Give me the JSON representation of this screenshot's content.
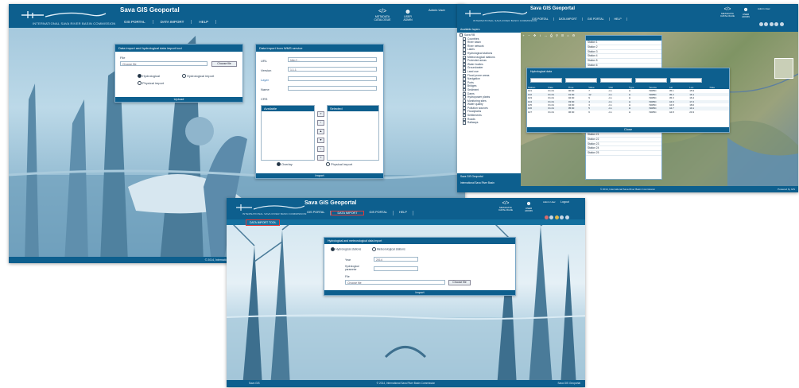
{
  "app_title": "Sava GIS Geoportal",
  "logo_caption": "INTERNATIONAL SAVA RIVER BASIN COMMISSION",
  "nav": [
    "GIS PORTAL",
    "DATA IMPORT",
    "GIS PORTAL",
    "HELP"
  ],
  "header_icons": {
    "metadata": "METADATA CATALOGUE",
    "user": "USER ADMIN",
    "admin_user": "Admin User",
    "logout": "Logout"
  },
  "screen1": {
    "panel_left": {
      "title": "Data import and hydrological data import tool",
      "file_label": "File",
      "file_placeholder": "Choose file",
      "choose_button": "Choose file",
      "radio_a": "Hydrological",
      "radio_b": "Hydrological import",
      "radio_c": "Physical import",
      "bar_label": "Upload"
    },
    "panel_right": {
      "title": "Data import from WMS service",
      "url_label": "URL",
      "url_value": "http://...",
      "version_label": "Version",
      "version_value": "1.1.1",
      "layer_label": "Layer",
      "name_label": "Name",
      "crs_label": "CRS",
      "available_label": "Available",
      "selected_label": "Selected",
      "radio_a": "Overlay",
      "radio_b": "Physical import",
      "bar_label": "Import"
    },
    "footer": "© 2014, International Sava River Basin Commission"
  },
  "screen2": {
    "tree_title": "Available layers",
    "tree_items": [
      "Sava RB",
      "Countries",
      "River basin",
      "River network",
      "Lakes",
      "Hydrological stations",
      "Meteorological stations",
      "Protected areas",
      "Water bodies",
      "Groundwater",
      "Land use",
      "Flood prone areas",
      "Navigation",
      "Ports",
      "Bridges",
      "Sediment",
      "Dams",
      "Hydropower plants",
      "Monitoring sites",
      "Water quality",
      "Pollution sources",
      "Floodplains",
      "Settlements",
      "Roads",
      "Railways"
    ],
    "tree_footer_1": "Sava GIS Geoportal",
    "tree_footer_2": "International Sava River Basin",
    "grid_title": "Hydrological data",
    "grid_headers": [
      "Station",
      "Date",
      "Time",
      "Value",
      "Unit",
      "Type",
      "Source",
      "Lat",
      "Lon",
      "Note"
    ],
    "grid_rows": [
      [
        "101",
        "01.01",
        "00:00",
        "7",
        "cm",
        "H",
        "ISRBC",
        "45.1",
        "15.9",
        ""
      ],
      [
        "102",
        "01.01",
        "01:00",
        "12",
        "cm",
        "H",
        "ISRBC",
        "45.2",
        "16.1",
        ""
      ],
      [
        "103",
        "01.01",
        "02:00",
        "9",
        "cm",
        "H",
        "ISRBC",
        "45.3",
        "16.4",
        ""
      ],
      [
        "104",
        "01.01",
        "03:00",
        "4",
        "cm",
        "H",
        "ISRBC",
        "44.9",
        "17.2",
        ""
      ],
      [
        "105",
        "01.01",
        "04:00",
        "3",
        "cm",
        "H",
        "ISRBC",
        "44.8",
        "18.0",
        ""
      ],
      [
        "106",
        "01.01",
        "05:00",
        "5",
        "cm",
        "H",
        "ISRBC",
        "44.7",
        "19.1",
        ""
      ],
      [
        "107",
        "01.01",
        "06:00",
        "6",
        "cm",
        "H",
        "ISRBC",
        "44.8",
        "20.3",
        ""
      ]
    ],
    "grid_bar": "Close",
    "list_items": [
      "Station 1",
      "Station 2",
      "Station 3",
      "Station 4",
      "Station 5",
      "Station 6",
      "Station 7",
      "Station 8",
      "Station 9",
      "Station 10",
      "Station 11",
      "Station 12",
      "Station 13",
      "Station 14",
      "Station 15",
      "Station 16",
      "Station 17",
      "Station 18",
      "Station 19",
      "Station 20",
      "Station 21",
      "Station 22",
      "Station 23",
      "Station 24",
      "Station 25"
    ],
    "footer": "© 2014, International Sava River Basin Commission",
    "footer_right": "Powered by GIS"
  },
  "screen3": {
    "subnav": "DATA IMPORT TOOL",
    "panel": {
      "title": "Hydrological and meteorological data import",
      "radio_a": "Hydrological stations",
      "radio_b": "Meteorological stations",
      "year_label": "Year",
      "year_value": "2014",
      "param_label": "Hydrological parameter",
      "file_label": "File",
      "file_placeholder": "Choose file",
      "choose_button": "Choose file",
      "bar_label": "Import"
    },
    "footer": "© 2014, International Sava River Basin Commission",
    "footer_right": "Sava GIS Geoportal",
    "logo_bottom": "Sava GIS"
  },
  "colors": {
    "header": "#0d5f8e",
    "accent_red": "#e03a3a",
    "panel_border": "#7aa8c7"
  }
}
